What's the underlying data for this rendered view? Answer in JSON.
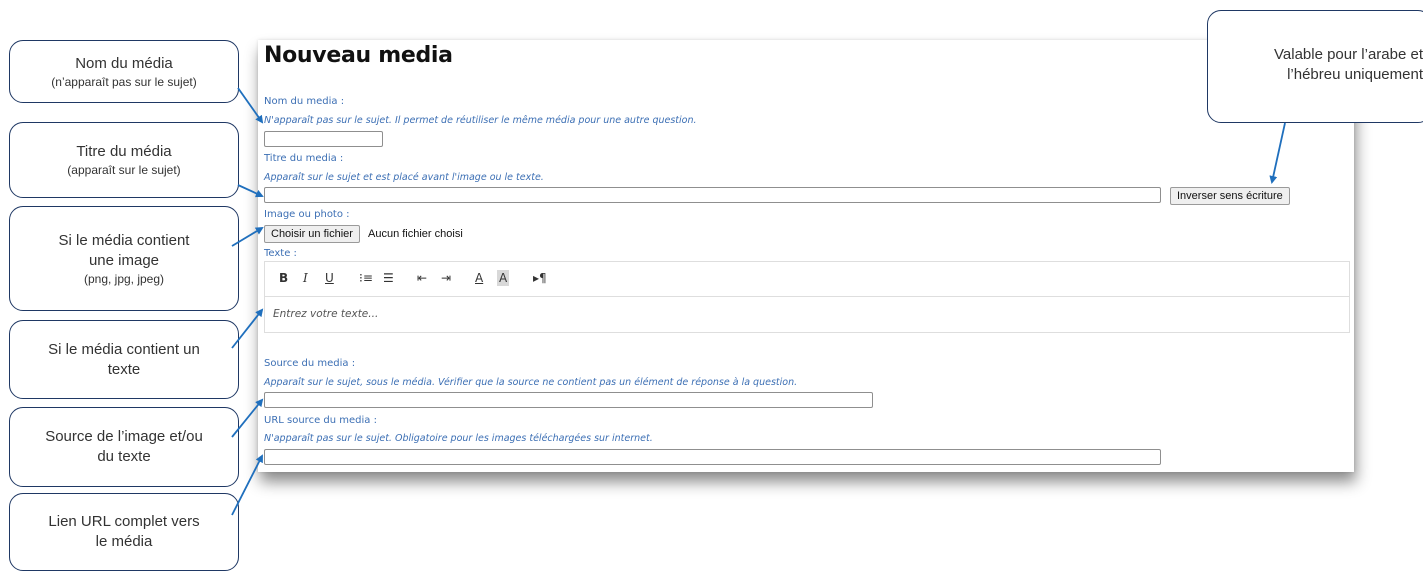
{
  "form": {
    "title": "Nouveau media",
    "name_label": "Nom du media :",
    "name_hint": "N'apparaît pas sur le sujet. Il permet de réutiliser le même média pour une autre question.",
    "title_label": "Titre du media :",
    "title_hint": "Apparaît sur le sujet et est placé avant l'image ou le texte.",
    "reverse_button": "Inverser sens écriture",
    "image_label": "Image ou photo :",
    "file_button": "Choisir un fichier",
    "file_status": "Aucun fichier choisi",
    "text_label": "Texte :",
    "editor_placeholder": "Entrez votre texte...",
    "source_label": "Source du media :",
    "source_hint": "Apparaît sur le sujet, sous le média. Vérifier que la source ne contient pas un élément de réponse à la question.",
    "url_label": "URL source du media :",
    "url_hint": "N'apparaît pas sur le sujet. Obligatoire pour les images téléchargées sur internet."
  },
  "toolbar": {
    "bold": "B",
    "italic": "I",
    "underline": "U",
    "ordered_list": "⁝≡",
    "unordered_list": "☰",
    "outdent": "⇤",
    "indent": "⇥",
    "font_color": "A",
    "bg_color": "A",
    "text_direction": "▸¶"
  },
  "callouts": {
    "name": {
      "main": "Nom du média",
      "sub": "(n’apparaît pas sur le sujet)"
    },
    "title": {
      "main": "Titre du média",
      "sub": "(apparaît sur le sujet)"
    },
    "image": {
      "line1": "Si le média contient",
      "line2": "une image",
      "sub": "(png, jpg, jpeg)"
    },
    "text": {
      "line1": "Si le média contient un",
      "line2": "texte"
    },
    "source": {
      "line1": "Source de l’image et/ou",
      "line2": "du texte"
    },
    "url": {
      "line1": "Lien URL complet vers",
      "line2": "le média"
    },
    "reverse": {
      "line1": "Valable pour l’arabe et",
      "line2": "l’hébreu uniquement"
    }
  },
  "colors": {
    "accent_blue": "#3c6fb4",
    "arrow_blue": "#1f6fbd",
    "callout_border": "#1f3864"
  }
}
